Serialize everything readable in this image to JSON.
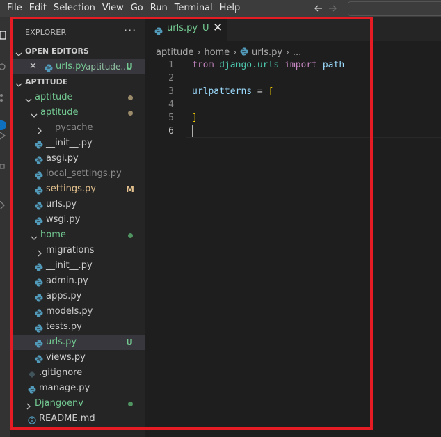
{
  "menubar": {
    "items": [
      "File",
      "Edit",
      "Selection",
      "View",
      "Go",
      "Run",
      "Terminal",
      "Help"
    ]
  },
  "explorer": {
    "title": "EXPLORER",
    "more": "···",
    "open_editors": {
      "header": "OPEN EDITORS",
      "items": [
        {
          "close": "✕",
          "name": "urls.py",
          "folder": "aptitude...",
          "status": "U"
        }
      ]
    },
    "workspace": {
      "header": "APTITUDE",
      "tree": [
        {
          "label": "aptitude",
          "type": "folder",
          "dot": true
        },
        {
          "label": "aptitude",
          "type": "folder",
          "dot": true
        },
        {
          "label": "__pycache__",
          "type": "folder"
        },
        {
          "label": "__init__.py",
          "type": "py"
        },
        {
          "label": "asgi.py",
          "type": "py"
        },
        {
          "label": "local_settings.py",
          "type": "py"
        },
        {
          "label": "settings.py",
          "type": "py",
          "status": "M"
        },
        {
          "label": "urls.py",
          "type": "py"
        },
        {
          "label": "wsgi.py",
          "type": "py"
        },
        {
          "label": "home",
          "type": "folder",
          "dot": true
        },
        {
          "label": "migrations",
          "type": "folder"
        },
        {
          "label": "__init__.py",
          "type": "py"
        },
        {
          "label": "admin.py",
          "type": "py"
        },
        {
          "label": "apps.py",
          "type": "py"
        },
        {
          "label": "models.py",
          "type": "py"
        },
        {
          "label": "tests.py",
          "type": "py"
        },
        {
          "label": "urls.py",
          "type": "py",
          "status": "U"
        },
        {
          "label": "views.py",
          "type": "py"
        },
        {
          "label": ".gitignore",
          "type": "git"
        },
        {
          "label": "manage.py",
          "type": "py"
        },
        {
          "label": "Djangoenv",
          "type": "folder",
          "dot": true
        },
        {
          "label": "README.md",
          "type": "info"
        }
      ]
    }
  },
  "editor": {
    "tab": {
      "name": "urls.py",
      "status": "U",
      "close": "✕"
    },
    "breadcrumb": [
      "aptitude",
      "home",
      "urls.py",
      "..."
    ],
    "lines": [
      {
        "n": "1",
        "tokens": [
          {
            "t": "from",
            "c": "kw-from"
          },
          {
            "t": " django.urls ",
            "c": "mod"
          },
          {
            "t": "import",
            "c": "kw-from"
          },
          {
            "t": " path",
            "c": "id"
          }
        ]
      },
      {
        "n": "2",
        "tokens": []
      },
      {
        "n": "3",
        "tokens": [
          {
            "t": "urlpatterns",
            "c": "id"
          },
          {
            "t": " = ",
            "c": "op"
          },
          {
            "t": "[",
            "c": "brk"
          }
        ]
      },
      {
        "n": "4",
        "tokens": []
      },
      {
        "n": "5",
        "tokens": [
          {
            "t": "]",
            "c": "brk"
          }
        ]
      },
      {
        "n": "6",
        "tokens": []
      }
    ]
  },
  "colors": {
    "untracked": "#73c991",
    "modified": "#e2c08d",
    "gitignored": "#8c8c8c",
    "selection": "#37373d",
    "annotation_frame": "#e51c23"
  }
}
